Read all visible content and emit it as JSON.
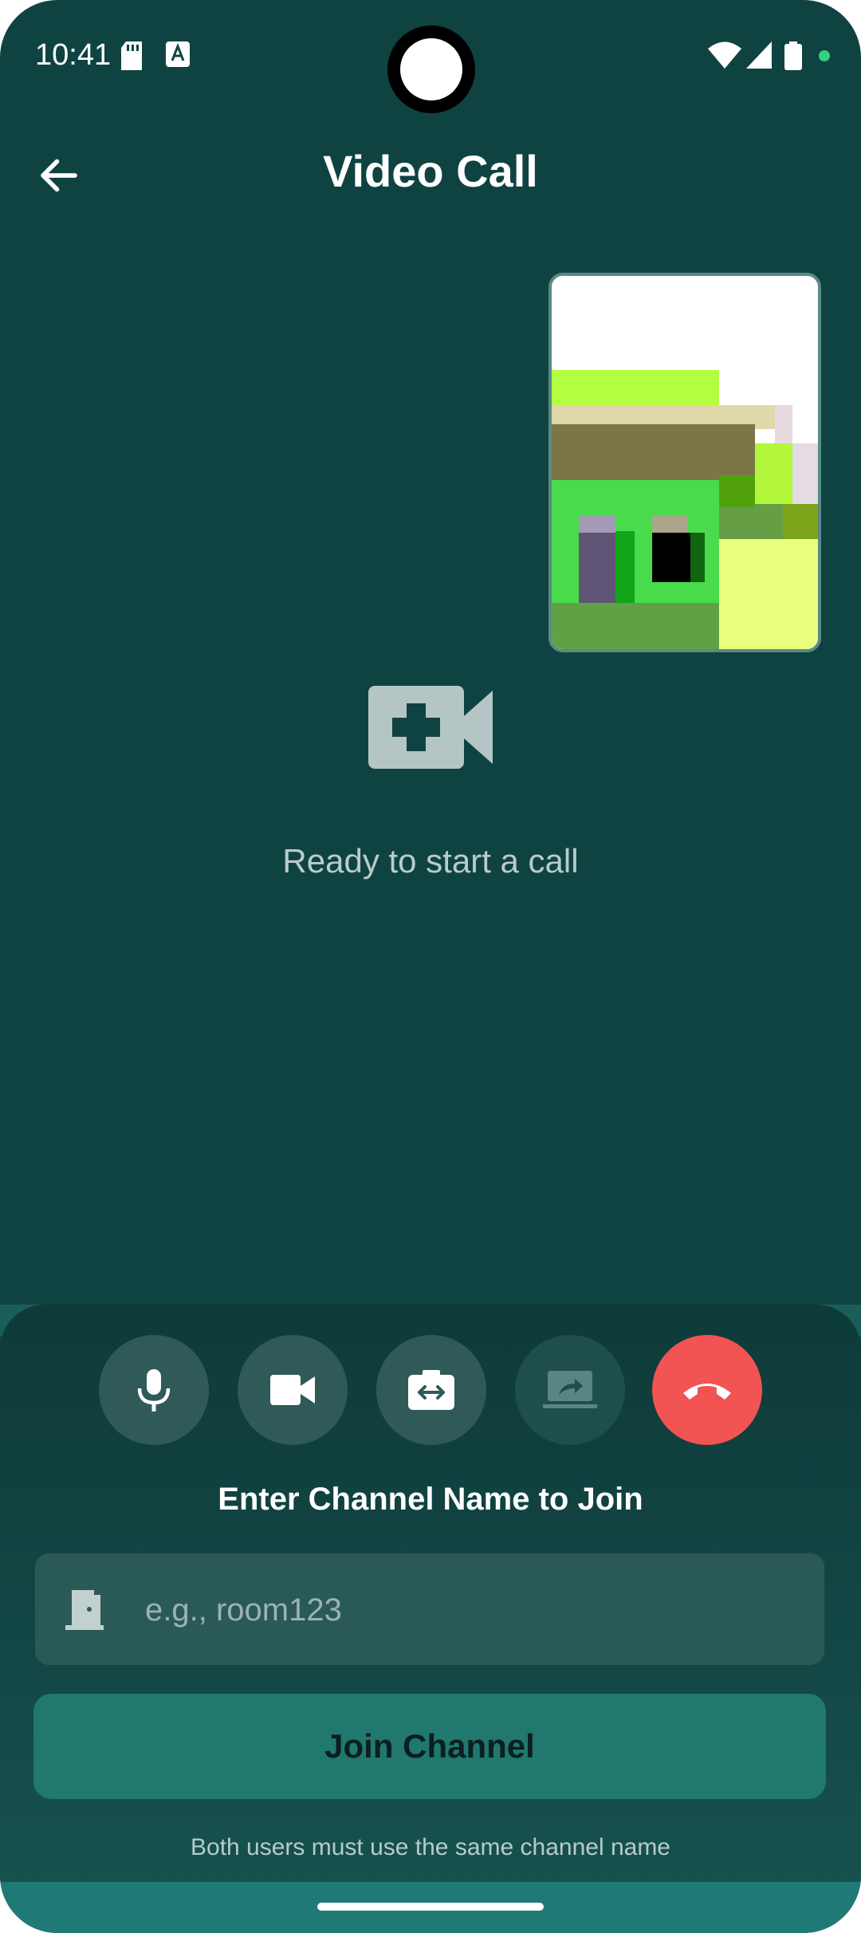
{
  "status_bar": {
    "time": "10:41",
    "icons": [
      "sd-card-icon",
      "font-a-icon",
      "wifi-icon",
      "cell-signal-icon",
      "battery-icon",
      "privacy-dot-icon"
    ]
  },
  "header": {
    "title": "Video Call",
    "back_icon": "arrow-left-icon"
  },
  "empty_state": {
    "icon": "video-plus-icon",
    "text": "Ready to start a call"
  },
  "controls": [
    {
      "icon": "mic-icon"
    },
    {
      "icon": "videocam-icon"
    },
    {
      "icon": "switch-camera-icon"
    },
    {
      "icon": "screen-share-icon"
    },
    {
      "icon": "call-end-icon"
    }
  ],
  "channel": {
    "label": "Enter Channel Name to Join",
    "placeholder": "e.g., room123",
    "value": "",
    "icon": "door-icon"
  },
  "join_button": {
    "label": "Join Channel"
  },
  "hint": "Both users must use the same channel name",
  "colors": {
    "background": "#0f4342",
    "accent": "#20786f",
    "end_call": "#f25353",
    "control_bg": "#2f5a58"
  }
}
